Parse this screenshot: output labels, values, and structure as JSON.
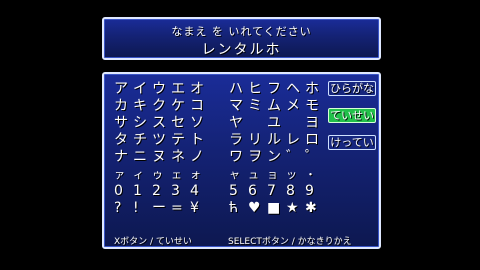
{
  "prompt": "なまえ を いれてください",
  "name_value": "レンタルホ",
  "grid_rows": [
    [
      "ア",
      "イ",
      "ウ",
      "エ",
      "オ",
      "",
      "ハ",
      "ヒ",
      "フ",
      "ヘ",
      "ホ"
    ],
    [
      "カ",
      "キ",
      "ク",
      "ケ",
      "コ",
      "",
      "マ",
      "ミ",
      "ム",
      "メ",
      "モ"
    ],
    [
      "サ",
      "シ",
      "ス",
      "セ",
      "ソ",
      "",
      "ヤ",
      "",
      "ユ",
      "",
      "ヨ"
    ],
    [
      "タ",
      "チ",
      "ツ",
      "テ",
      "ト",
      "",
      "ラ",
      "リ",
      "ル",
      "レ",
      "ロ"
    ],
    [
      "ナ",
      "ニ",
      "ヌ",
      "ネ",
      "ノ",
      "",
      "ワ",
      "ヲ",
      "ン",
      "゛",
      "゜"
    ],
    [
      "ァ",
      "ィ",
      "ゥ",
      "ェ",
      "ォ",
      "",
      "ャ",
      "ュ",
      "ョ",
      "ッ",
      "・"
    ],
    [
      "0",
      "1",
      "2",
      "3",
      "4",
      "",
      "5",
      "6",
      "7",
      "8",
      "9"
    ],
    [
      "?",
      "!",
      "ー",
      "=",
      "¥",
      "",
      "ћ",
      "♥",
      "■",
      "★",
      "✱"
    ]
  ],
  "small_rows": [
    5
  ],
  "modes": {
    "hiragana": "ひらがな",
    "katakana": "ていせい",
    "confirm": "けってい"
  },
  "footer": {
    "left": "Xボタン / ていせい",
    "right": "SELECTボタン / かなきりかえ"
  },
  "colors": {
    "panel": "#142274",
    "border": "#dfe8ff",
    "active_mode": "#22c04a"
  }
}
